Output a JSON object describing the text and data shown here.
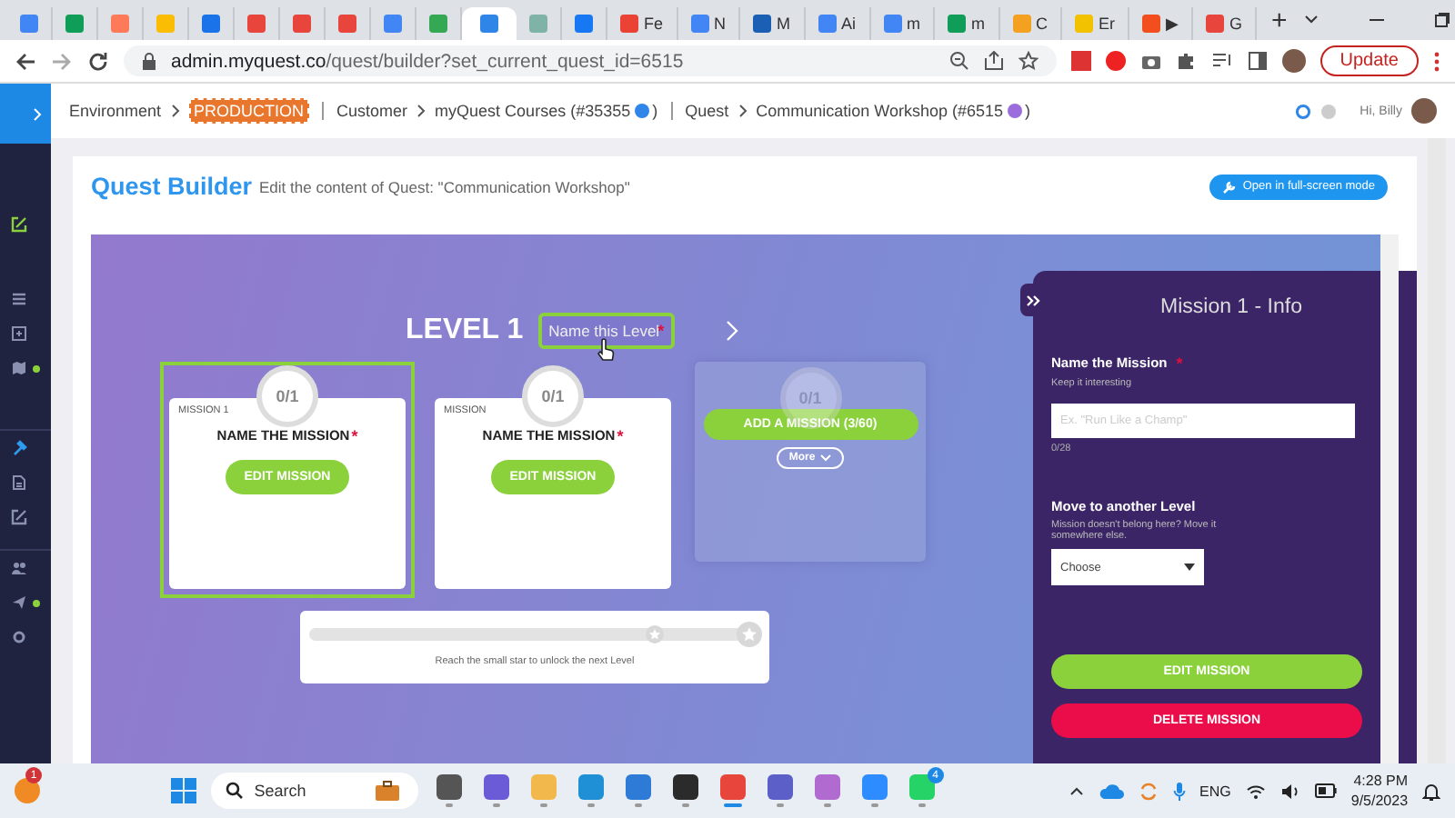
{
  "browser": {
    "tabs": [
      {
        "selected": false,
        "color": "#4285f4"
      },
      {
        "selected": false,
        "color": "#0f9d58"
      },
      {
        "selected": false,
        "color": "#ff7a59"
      },
      {
        "selected": false,
        "color": "#fbbc04"
      },
      {
        "selected": false,
        "color": "#1a73e8"
      },
      {
        "selected": false,
        "color": "#e8453c"
      },
      {
        "selected": false,
        "color": "#e8453c"
      },
      {
        "selected": false,
        "color": "#e8453c"
      },
      {
        "selected": false,
        "color": "#4285f4"
      },
      {
        "selected": false,
        "color": "#34a853"
      },
      {
        "selected": true,
        "color": "#2f86e8"
      },
      {
        "selected": false,
        "color": "#7fb3a8"
      },
      {
        "selected": false,
        "color": "#1877f2"
      },
      {
        "selected": false,
        "color": "#ea4335",
        "label": "Fe"
      },
      {
        "selected": false,
        "color": "#4285f4",
        "label": "N"
      },
      {
        "selected": false,
        "color": "#1a5fb4",
        "label": "M"
      },
      {
        "selected": false,
        "color": "#4285f4",
        "label": "Ai"
      },
      {
        "selected": false,
        "color": "#4285f4",
        "label": "m"
      },
      {
        "selected": false,
        "color": "#0f9d58",
        "label": "m"
      },
      {
        "selected": false,
        "color": "#f4a020",
        "label": "C"
      },
      {
        "selected": false,
        "color": "#f2c200",
        "label": "Er"
      },
      {
        "selected": false,
        "color": "#f24e1e",
        "label": "▶"
      },
      {
        "selected": false,
        "color": "#e8453c",
        "label": "G"
      }
    ],
    "new_tab": "+",
    "address": {
      "host": "admin.myquest.co",
      "path": "/quest/builder?set_current_quest_id=6515"
    },
    "update_button": "Update"
  },
  "sidebar": {
    "items": [
      {
        "kind": "edit",
        "color": "#8bd13c",
        "dot": false
      },
      {
        "kind": "list",
        "color": "#8a90b0",
        "dot": false
      },
      {
        "kind": "box",
        "color": "#8a90b0",
        "dot": false
      },
      {
        "kind": "map",
        "color": "#8a90b0",
        "dot": true
      },
      {
        "kind": "hammer",
        "color": "#2f9bf0",
        "dot": false
      },
      {
        "kind": "file",
        "color": "#8a90b0",
        "dot": false
      },
      {
        "kind": "edit",
        "color": "#8a90b0",
        "dot": false
      },
      {
        "kind": "people",
        "color": "#8a90b0",
        "dot": false
      },
      {
        "kind": "send",
        "color": "#8a90b0",
        "dot": true
      },
      {
        "kind": "gear",
        "color": "#8a90b0",
        "dot": false
      }
    ]
  },
  "breadcrumb": [
    {
      "kind": "env",
      "label": "Environment",
      "value": "PRODUCTION"
    },
    {
      "kind": "link",
      "label": "Customer",
      "value": "myQuest Courses (#35355",
      "suffix": ")",
      "color": "#2f86e8"
    },
    {
      "kind": "link",
      "label": "Quest",
      "value": "Communication Workshop (#6515",
      "suffix": ")",
      "color": "#9b6ddc"
    }
  ],
  "user": {
    "greeting": "Hi, Billy"
  },
  "builder": {
    "title": "Quest Builder",
    "subtitle": "Edit the content of Quest: \"Communication Workshop\"",
    "fullscreen_button": "Open in full-screen mode"
  },
  "level": {
    "title": "LEVEL 1",
    "name_placeholder": "Name this Level",
    "required": "*"
  },
  "cards": [
    {
      "kind": "mission",
      "selected": true,
      "counter": "0/1",
      "label": "MISSION 1",
      "title": "NAME THE MISSION",
      "required": "*",
      "button": "EDIT MISSION"
    },
    {
      "kind": "mission",
      "selected": false,
      "counter": "0/1",
      "label": "MISSION",
      "title": "NAME THE MISSION",
      "required": "*",
      "button": "EDIT MISSION"
    },
    {
      "kind": "add",
      "counter": "0/1",
      "button": "ADD A MISSION (3/60)",
      "more": "More"
    }
  ],
  "progress": {
    "caption": "Reach the small star to unlock the next Level"
  },
  "panel": {
    "title": "Mission 1 - Info",
    "name_label": "Name the Mission",
    "required": "*",
    "name_hint": "Keep it interesting",
    "name_placeholder": "Ex. \"Run Like a Champ\"",
    "name_count": "0/28",
    "move_label": "Move to another Level",
    "move_hint": "Mission doesn't belong here? Move it somewhere else.",
    "move_select": "Choose",
    "edit_button": "EDIT MISSION",
    "delete_button": "DELETE MISSION"
  },
  "taskbar": {
    "notification_badge": "1",
    "search_placeholder": "Search",
    "apps": [
      {
        "color": "#555555",
        "active": false
      },
      {
        "color": "#6b5bd6",
        "active": false
      },
      {
        "color": "#f2b84b",
        "active": false
      },
      {
        "color": "#1f8fd6",
        "active": false
      },
      {
        "color": "#2d7bd6",
        "active": false
      },
      {
        "color": "#2b2b2b",
        "active": false
      },
      {
        "color": "#e8453c",
        "active": true
      },
      {
        "color": "#5b5fc7",
        "active": false
      },
      {
        "color": "#b06ad0",
        "active": false
      },
      {
        "color": "#2d8cff",
        "active": false
      },
      {
        "color": "#25d366",
        "active": false,
        "badge": "4"
      }
    ],
    "language": "ENG",
    "time": "4:28 PM",
    "date": "9/5/2023"
  }
}
